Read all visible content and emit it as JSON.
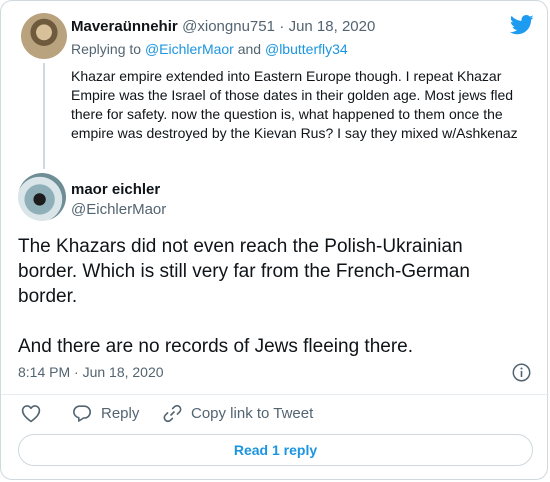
{
  "parent_tweet": {
    "display_name": "Maveraünnehir",
    "handle": "@xiongnu751",
    "date": "· Jun 18, 2020",
    "replying_prefix": "Replying to ",
    "replying_user_1": "@EichlerMaor",
    "replying_and": " and ",
    "replying_user_2": "@lbutterfly34",
    "text": "Khazar empire extended into Eastern Europe though. I repeat Khazar Empire was the Israel of those dates in their golden age. Most jews fled there for safety. now the question is, what happened to them once the empire was destroyed by the Kievan Rus? I say they mixed w/Ashkenaz"
  },
  "main_tweet": {
    "display_name": "maor eichler",
    "handle": "@EichlerMaor",
    "text": "The Khazars did not even reach the Polish-Ukrainian border. Which is still very far from the French-German border.\n\nAnd there are no records of Jews fleeing there.",
    "timestamp": "8:14 PM · Jun 18, 2020"
  },
  "actions": {
    "reply_label": "Reply",
    "copy_link_label": "Copy link to Tweet"
  },
  "read_replies_label": "Read 1 reply",
  "icons": {
    "brand": "twitter-bird-icon",
    "info": "info-icon",
    "like": "heart-icon",
    "reply": "speech-bubble-icon",
    "copy_link": "link-icon"
  },
  "colors": {
    "twitter_blue": "#1d9bf0",
    "link_blue": "#1b95e0",
    "muted_text": "#536471",
    "border": "#cfd9de"
  }
}
